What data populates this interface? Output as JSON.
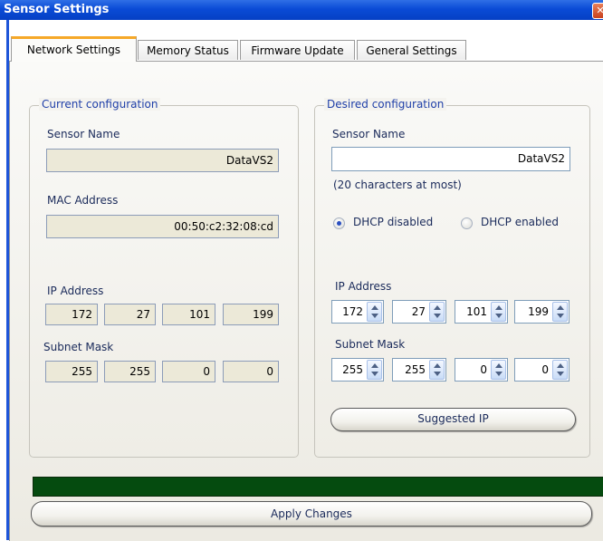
{
  "window": {
    "title": "Sensor Settings",
    "close_glyph": "✕"
  },
  "tabs": [
    "Network Settings",
    "Memory Status",
    "Firmware Update",
    "General Settings"
  ],
  "current": {
    "legend": "Current configuration",
    "sensor_name_label": "Sensor Name",
    "sensor_name": "DataVS2",
    "mac_label": "MAC Address",
    "mac": "00:50:c2:32:08:cd",
    "ip_label": "IP Address",
    "ip": [
      "172",
      "27",
      "101",
      "199"
    ],
    "mask_label": "Subnet Mask",
    "mask": [
      "255",
      "255",
      "0",
      "0"
    ]
  },
  "desired": {
    "legend": "Desired configuration",
    "sensor_name_label": "Sensor Name",
    "sensor_name": "DataVS2",
    "hint": "(20 characters at most)",
    "dhcp_disabled": "DHCP disabled",
    "dhcp_enabled": "DHCP enabled",
    "ip_label": "IP Address",
    "ip": [
      "172",
      "27",
      "101",
      "199"
    ],
    "mask_label": "Subnet Mask",
    "mask": [
      "255",
      "255",
      "0",
      "0"
    ],
    "suggested_ip": "Suggested IP"
  },
  "apply": "Apply Changes",
  "progress": {
    "fraction": 1.0,
    "color": "#054b0f"
  },
  "colors": {
    "titlebar": "#0a4bd6",
    "tab_highlight": "#f6a828",
    "legend": "#1f3fa8"
  }
}
